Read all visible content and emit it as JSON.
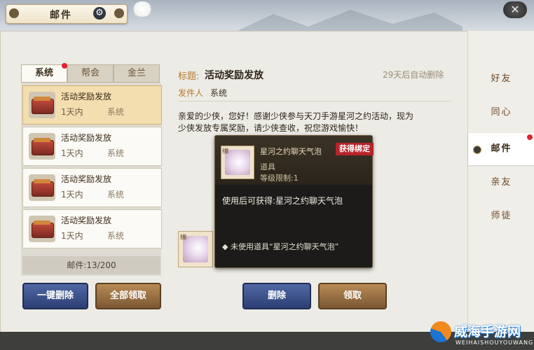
{
  "window": {
    "title": "邮件",
    "close_glyph": "✕"
  },
  "tabs": [
    {
      "label": "系统",
      "active": true,
      "has_badge": true
    },
    {
      "label": "帮会",
      "active": false
    },
    {
      "label": "金兰",
      "active": false
    }
  ],
  "mail_list": [
    {
      "title": "活动奖励发放",
      "time": "1天内",
      "from": "系统",
      "selected": true
    },
    {
      "title": "活动奖励发放",
      "time": "1天内",
      "from": "系统",
      "selected": false
    },
    {
      "title": "活动奖励发放",
      "time": "1天内",
      "from": "系统",
      "selected": false
    },
    {
      "title": "活动奖励发放",
      "time": "1天内",
      "from": "系统",
      "selected": false
    }
  ],
  "mail_count": "邮件:13/200",
  "left_buttons": {
    "delete_all": "一键删除",
    "claim_all": "全部领取"
  },
  "mail_detail": {
    "subject_label": "标题:",
    "subject": "活动奖励发放",
    "expire": "29天后自动删除",
    "sender_label": "发件人",
    "sender": "系统",
    "body_line1": "亲爱的少侠，您好！感谢少侠参与天刀手游星河之约活动，现为",
    "body_line2": "少侠发放专属奖励，请少侠查收，祝您游戏愉快！",
    "attachment_bind_mark": "绑"
  },
  "tooltip": {
    "bind_mark": "绑",
    "item_name": "星河之约聊天气泡",
    "tag": "获得绑定",
    "item_type": "道具",
    "level_req": "等级限制:1",
    "use_text": "使用后可获得:星河之约聊天气泡",
    "note": "◆ 未使用道具“星河之约聊天气泡”"
  },
  "detail_buttons": {
    "delete": "删除",
    "claim": "领取"
  },
  "side_nav": [
    {
      "label": "好友",
      "active": false
    },
    {
      "label": "同心",
      "active": false
    },
    {
      "label": "邮件",
      "active": true,
      "has_badge": true
    },
    {
      "label": "亲友",
      "active": false
    },
    {
      "label": "师徒",
      "active": false
    }
  ],
  "watermark": {
    "text": "威海手游网",
    "sub": "WEIHAISHOUYOUWANG"
  },
  "colors": {
    "accent_gold": "#b9782a",
    "badge_red": "#e0242c",
    "button_blue": "#2c3f74",
    "button_brown": "#7b5733",
    "tag_red": "#b7232a"
  },
  "icons": [
    "gear-icon",
    "close-icon",
    "gift-box-icon",
    "chat-bubble-item-icon"
  ]
}
